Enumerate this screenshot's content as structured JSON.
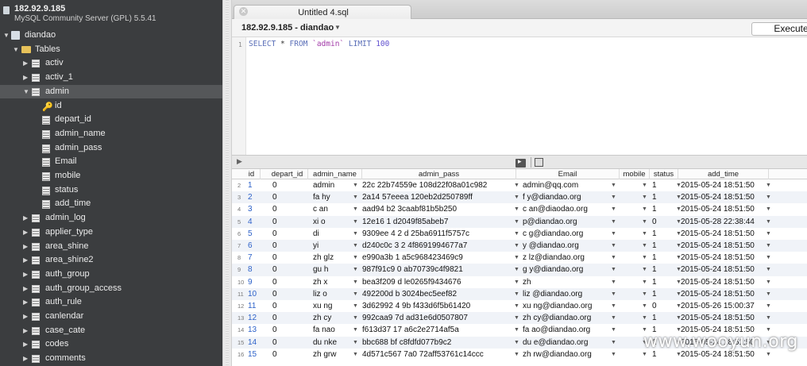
{
  "server": {
    "host": "182.92.9.185",
    "version": "MySQL Community Server (GPL) 5.5.41"
  },
  "tree": {
    "database": "diandao",
    "tables_folder": "Tables",
    "tables_before": [
      "activ",
      "activ_1"
    ],
    "selected_table": "admin",
    "columns": [
      "id",
      "depart_id",
      "admin_name",
      "admin_pass",
      "Email",
      "mobile",
      "status",
      "add_time"
    ],
    "tables_after": [
      "admin_log",
      "applier_type",
      "area_shine",
      "area_shine2",
      "auth_group",
      "auth_group_access",
      "auth_rule",
      "canlendar",
      "case_cate",
      "codes",
      "comments"
    ]
  },
  "tab": {
    "title": "Untitled 4.sql",
    "close_icon": "close-icon"
  },
  "query": {
    "context": "182.92.9.185 - diandao",
    "execute_label": "Execute",
    "line_number": "1",
    "sql_select": "SELECT",
    "sql_star": " * ",
    "sql_from": "FROM",
    "sql_table": " `admin` ",
    "sql_limit": "LIMIT",
    "sql_count": " 100"
  },
  "grid": {
    "columns": [
      "id",
      "depart_id",
      "admin_name",
      "admin_pass",
      "Email",
      "mobile",
      "status",
      "add_time"
    ],
    "rows": [
      {
        "rn": "2",
        "id": "1",
        "depart_id": "0",
        "admin_name": "admin",
        "admin_pass": "22c   22b74559e    108d22f08a01c982",
        "email": "admin@qq.com",
        "status": "1",
        "add_time": "2015-05-24 18:51:50"
      },
      {
        "rn": "3",
        "id": "2",
        "depart_id": "0",
        "admin_name": "fa   hy",
        "admin_pass": "2a14    57eeea      120eb2d250789ff",
        "email": "f      y@diandao.org",
        "status": "1",
        "add_time": "2015-05-24 18:51:50"
      },
      {
        "rn": "4",
        "id": "3",
        "depart_id": "0",
        "admin_name": "c   an",
        "admin_pass": "aad94     b2     3caabf81b5b250",
        "email": "c      an@diaodao.org",
        "status": "1",
        "add_time": "2015-05-24 18:51:50"
      },
      {
        "rn": "5",
        "id": "4",
        "depart_id": "0",
        "admin_name": "xi   o",
        "admin_pass": "12e16      1      d2049f85abeb7",
        "email": "      p@diandao.org",
        "status": "0",
        "add_time": "2015-05-28 22:38:44"
      },
      {
        "rn": "6",
        "id": "5",
        "depart_id": "0",
        "admin_name": "di",
        "admin_pass": "9309ee   4   2  d    25ba6911f5757c",
        "email": "c      g@diandao.org",
        "status": "1",
        "add_time": "2015-05-24 18:51:50"
      },
      {
        "rn": "7",
        "id": "6",
        "depart_id": "0",
        "admin_name": "yi",
        "admin_pass": "d240c0c    3   2     4f8691994677a7",
        "email": "y      @diandao.org",
        "status": "1",
        "add_time": "2015-05-24 18:51:50"
      },
      {
        "rn": "8",
        "id": "7",
        "depart_id": "0",
        "admin_name": "zh   glz",
        "admin_pass": "e990a3b     1     a5c968423469c9",
        "email": "z      lz@diandao.org",
        "status": "1",
        "add_time": "2015-05-24 18:51:50"
      },
      {
        "rn": "9",
        "id": "8",
        "depart_id": "0",
        "admin_name": "gu   h",
        "admin_pass": "987f91c9     0     ab70739c4f9821",
        "email": "g      y@diandao.org",
        "status": "1",
        "add_time": "2015-05-24 18:51:50"
      },
      {
        "rn": "10",
        "id": "9",
        "depart_id": "0",
        "admin_name": "zh   x",
        "admin_pass": "bea3f209     d     le0265f9434676",
        "email": "zh",
        "status": "1",
        "add_time": "2015-05-24 18:51:50"
      },
      {
        "rn": "11",
        "id": "10",
        "depart_id": "0",
        "admin_name": "liz   o",
        "admin_pass": "492200d     b     3024bec5eef82",
        "email": "liz      @diandao.org",
        "status": "1",
        "add_time": "2015-05-24 18:51:50"
      },
      {
        "rn": "12",
        "id": "11",
        "depart_id": "0",
        "admin_name": "xu   ng",
        "admin_pass": "3d62992     4   9b    f433d6f5b61420",
        "email": "xu      ng@diandao.org",
        "status": "0",
        "add_time": "2015-05-26 15:00:37"
      },
      {
        "rn": "13",
        "id": "12",
        "depart_id": "0",
        "admin_name": "zh   cy",
        "admin_pass": "992caa9     7d     ad31e6d0507807",
        "email": "zh      cy@diandao.org",
        "status": "1",
        "add_time": "2015-05-24 18:51:50"
      },
      {
        "rn": "14",
        "id": "13",
        "depart_id": "0",
        "admin_name": "fa   nao",
        "admin_pass": "f613d37     17     a6c2e2714af5a",
        "email": "fa      ao@diandao.org",
        "status": "1",
        "add_time": "2015-05-24 18:51:50"
      },
      {
        "rn": "15",
        "id": "14",
        "depart_id": "0",
        "admin_name": "du   nke",
        "admin_pass": "bbc688     bf     c8fdfd077b9c2",
        "email": "du      e@diandao.org",
        "status": "1",
        "add_time": "2015-05-24 18:51:50"
      },
      {
        "rn": "16",
        "id": "15",
        "depart_id": "0",
        "admin_name": "zh   grw",
        "admin_pass": "4d571c567     7a0     72aff53761c14ccc",
        "email": "zh      rw@diandao.org",
        "status": "1",
        "add_time": "2015-05-24 18:51:50"
      }
    ]
  },
  "watermark": "www.wooyun.org"
}
